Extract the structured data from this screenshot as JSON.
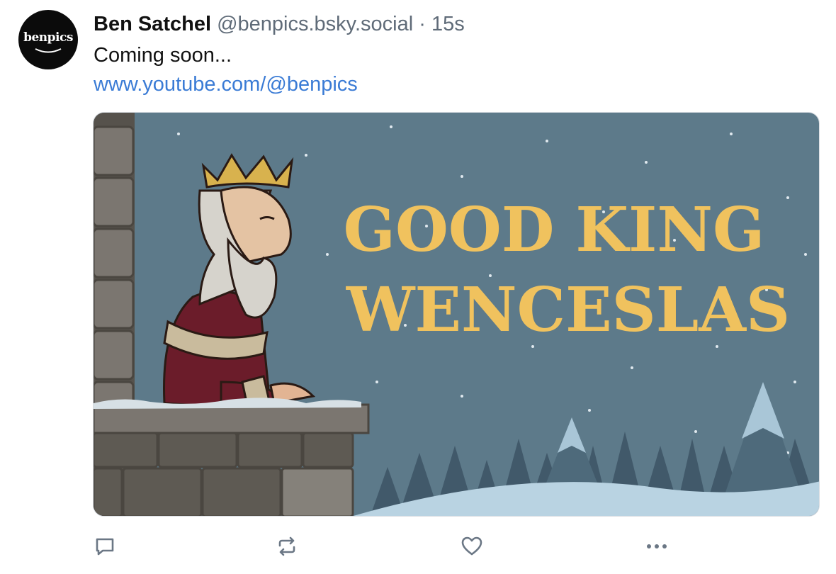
{
  "post": {
    "author_name": "Ben Satchel",
    "author_handle": "@benpics.bsky.social",
    "separator": "·",
    "time": "15s",
    "text": "Coming soon...",
    "link": "www.youtube.com/@benpics"
  },
  "avatar": {
    "logo_text": "benpics"
  },
  "media": {
    "title_line1": "GOOD KING",
    "title_line2": "WENCESLAS"
  },
  "actions": [
    "reply-icon",
    "repost-icon",
    "like-icon",
    "more-icon"
  ],
  "colors": {
    "link": "#3a7bd5",
    "muted": "#5f6b78",
    "sky": "#5d7a8a",
    "title": "#f0c25e"
  }
}
